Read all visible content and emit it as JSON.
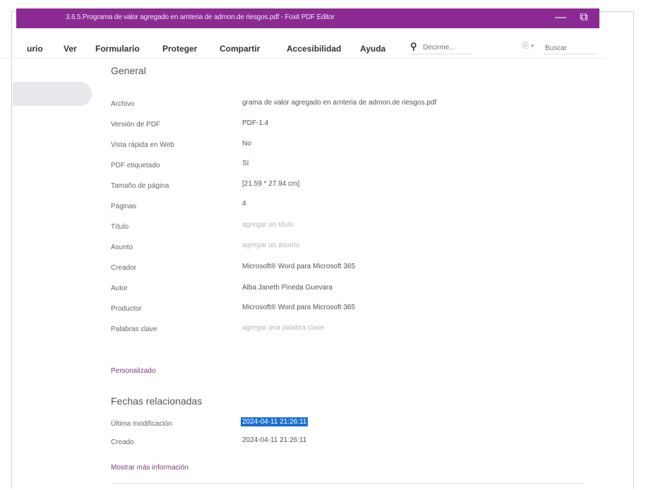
{
  "window": {
    "title": "3.6.5.Programa de valor agregado en arnteria de admon.de riesgos.pdf - Foxit PDF Editor",
    "minimize_glyph": "—",
    "restore_glyph": "⧉"
  },
  "menu": {
    "items": [
      "urio",
      "Ver",
      "Formulario",
      "Proteger",
      "Compartir",
      "Accesibilidad",
      "Ayuda"
    ],
    "tell_me_placeholder": "Decirme...",
    "search_placeholder": "Buscar"
  },
  "general": {
    "title": "General",
    "properties": [
      {
        "label": "Archivo",
        "value": "grama de valor agregado en arnteria de admon.de riesgos.pdf"
      },
      {
        "label": "Versión de PDF",
        "value": "PDF-1.4"
      },
      {
        "label": "Vista rápida en Web",
        "value": "No"
      },
      {
        "label": "PDF etiquetado",
        "value": "Sí"
      },
      {
        "label": "Tamaño de página",
        "value": "[21.59 * 27.94 cm]"
      },
      {
        "label": "Páginas",
        "value": "4"
      },
      {
        "label": "Título",
        "value": "agregar un título"
      },
      {
        "label": "Asunto",
        "value": "agregar un asunto"
      },
      {
        "label": "Creador",
        "value": "Microsoft® Word para Microsoft 365"
      },
      {
        "label": "Autor",
        "value": "Alba Janeth Pineda Guevara"
      },
      {
        "label": "Productor",
        "value": "Microsoft® Word para Microsoft 365"
      },
      {
        "label": "Palabras clave",
        "value": "agregar una palabra clave"
      }
    ]
  },
  "custom_link": "Personalizado",
  "dates": {
    "title": "Fechas relacionadas",
    "modified_label": "Última modificación",
    "modified_value": "2024-04-11 21:26:11",
    "created_label": "Creado",
    "created_value": "2024-04-11 21:26:11"
  },
  "more_info_link": "Mostrar más información"
}
